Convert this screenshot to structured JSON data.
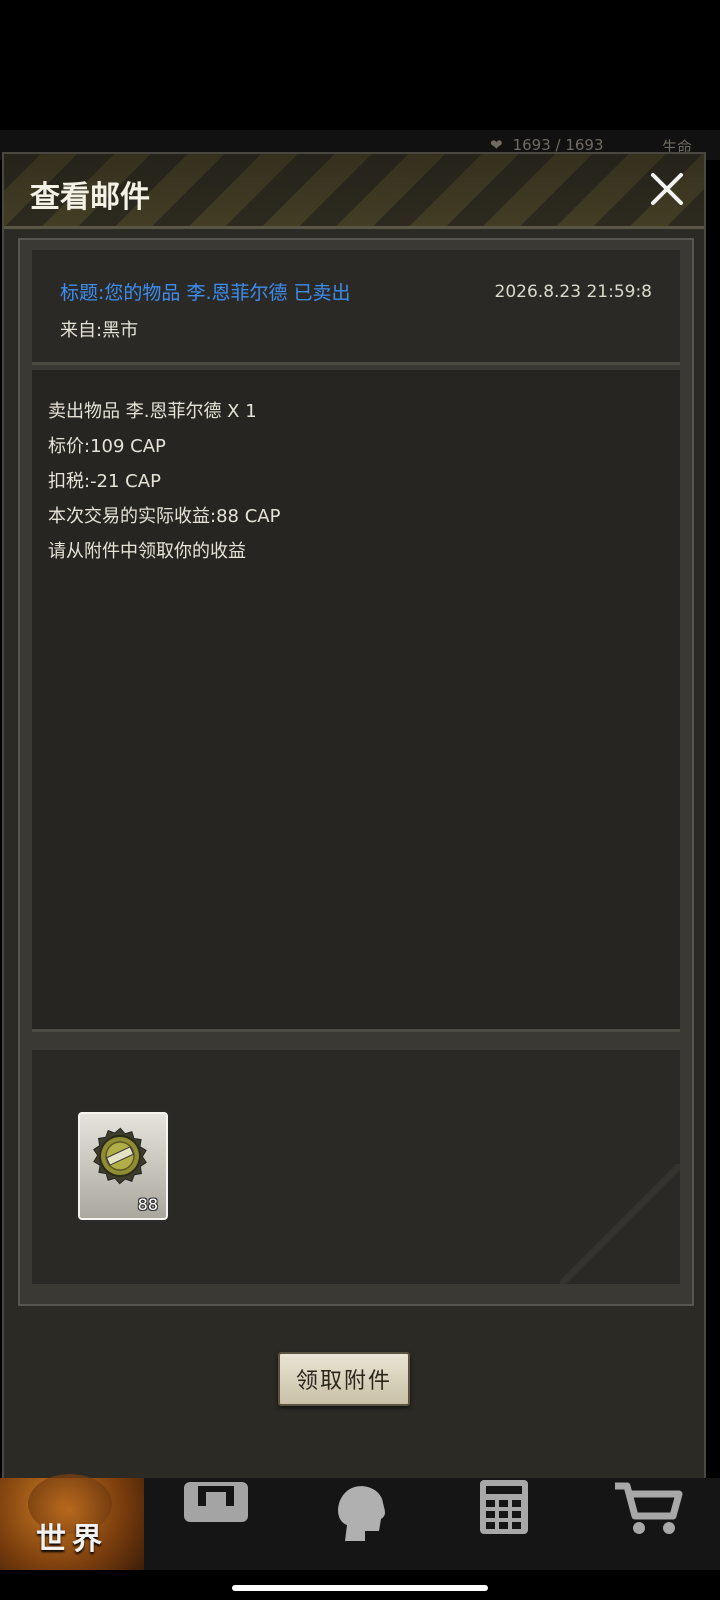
{
  "background": {
    "hp_text": "1693 / 1693",
    "life_text": "生命"
  },
  "modal": {
    "title": "查看邮件",
    "close_icon": "close-icon"
  },
  "mail": {
    "subject": "标题:您的物品 李.恩菲尔德 已卖出",
    "date": "2026.8.23 21:59:8",
    "from": "来自:黑市",
    "body_lines": [
      "卖出物品 李.恩菲尔德 X 1",
      "标价:109 CAP",
      "扣税:-21 CAP",
      "本次交易的实际收益:88 CAP",
      "请从附件中领取你的收益"
    ]
  },
  "attachment": {
    "icon": "bottle-cap-icon",
    "count": "88"
  },
  "claim_button": "领取附件",
  "bottom_nav": {
    "items": [
      {
        "label": "世界",
        "icon": "globe-icon",
        "active": true
      },
      {
        "label": "",
        "icon": "backpack-icon"
      },
      {
        "label": "",
        "icon": "character-head-icon"
      },
      {
        "label": "",
        "icon": "calculator-icon"
      },
      {
        "label": "",
        "icon": "shopping-cart-icon"
      }
    ]
  },
  "colors": {
    "subject": "#3d8df0",
    "panel": "#262522",
    "accent_nav": "#c87a22"
  }
}
